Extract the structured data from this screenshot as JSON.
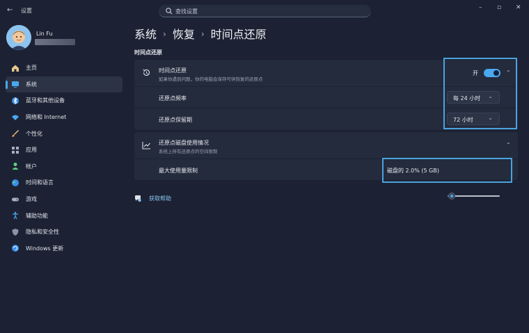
{
  "window": {
    "back_glyph": "←",
    "title": "设置",
    "minimize_glyph": "–",
    "maximize_glyph": "▫",
    "close_glyph": "✕"
  },
  "search": {
    "placeholder": "查找设置"
  },
  "user": {
    "name": "Lin Fu"
  },
  "sidebar": {
    "items": [
      {
        "label": "主页",
        "icon": "home-icon",
        "active": false
      },
      {
        "label": "系统",
        "icon": "system-icon",
        "active": true
      },
      {
        "label": "蓝牙和其他设备",
        "icon": "bluetooth-icon",
        "active": false
      },
      {
        "label": "网络和 Internet",
        "icon": "wifi-icon",
        "active": false
      },
      {
        "label": "个性化",
        "icon": "brush-icon",
        "active": false
      },
      {
        "label": "应用",
        "icon": "apps-icon",
        "active": false
      },
      {
        "label": "帐户",
        "icon": "person-icon",
        "active": false
      },
      {
        "label": "时间和语言",
        "icon": "globe-icon",
        "active": false
      },
      {
        "label": "游戏",
        "icon": "gamepad-icon",
        "active": false
      },
      {
        "label": "辅助功能",
        "icon": "accessibility-icon",
        "active": false
      },
      {
        "label": "隐私和安全性",
        "icon": "shield-icon",
        "active": false
      },
      {
        "label": "Windows 更新",
        "icon": "update-icon",
        "active": false
      }
    ]
  },
  "breadcrumb": {
    "parts": [
      "系统",
      "恢复",
      "时间点还原"
    ],
    "separator": "›"
  },
  "section_title": "时间点还原",
  "restore_card": {
    "title": "时间点还原",
    "subtitle": "如果你遇到问题，你的电脑会保存可供恢复的还原点",
    "toggle_label": "开",
    "toggle_on": true,
    "expand_glyph": "⌃",
    "frequency": {
      "label": "还原点频率",
      "value": "每 24 小时"
    },
    "retention": {
      "label": "还原点保留期",
      "value": "72 小时"
    },
    "dropdown_glyph": "⌄"
  },
  "usage_card": {
    "title": "还原点磁盘使用情况",
    "subtitle": "系统上所有还原点的空间限制",
    "expand_glyph": "⌃",
    "max_limit": {
      "label": "最大使用量限制",
      "value_text": "磁盘的 2.0% (5 GB)",
      "level_fraction": 0.02
    }
  },
  "help": {
    "label": "获取帮助"
  },
  "colors": {
    "accent": "#4aa8f0",
    "highlight_box": "#4aa3e0",
    "background": "#1c2233",
    "card": "#242b3c"
  }
}
